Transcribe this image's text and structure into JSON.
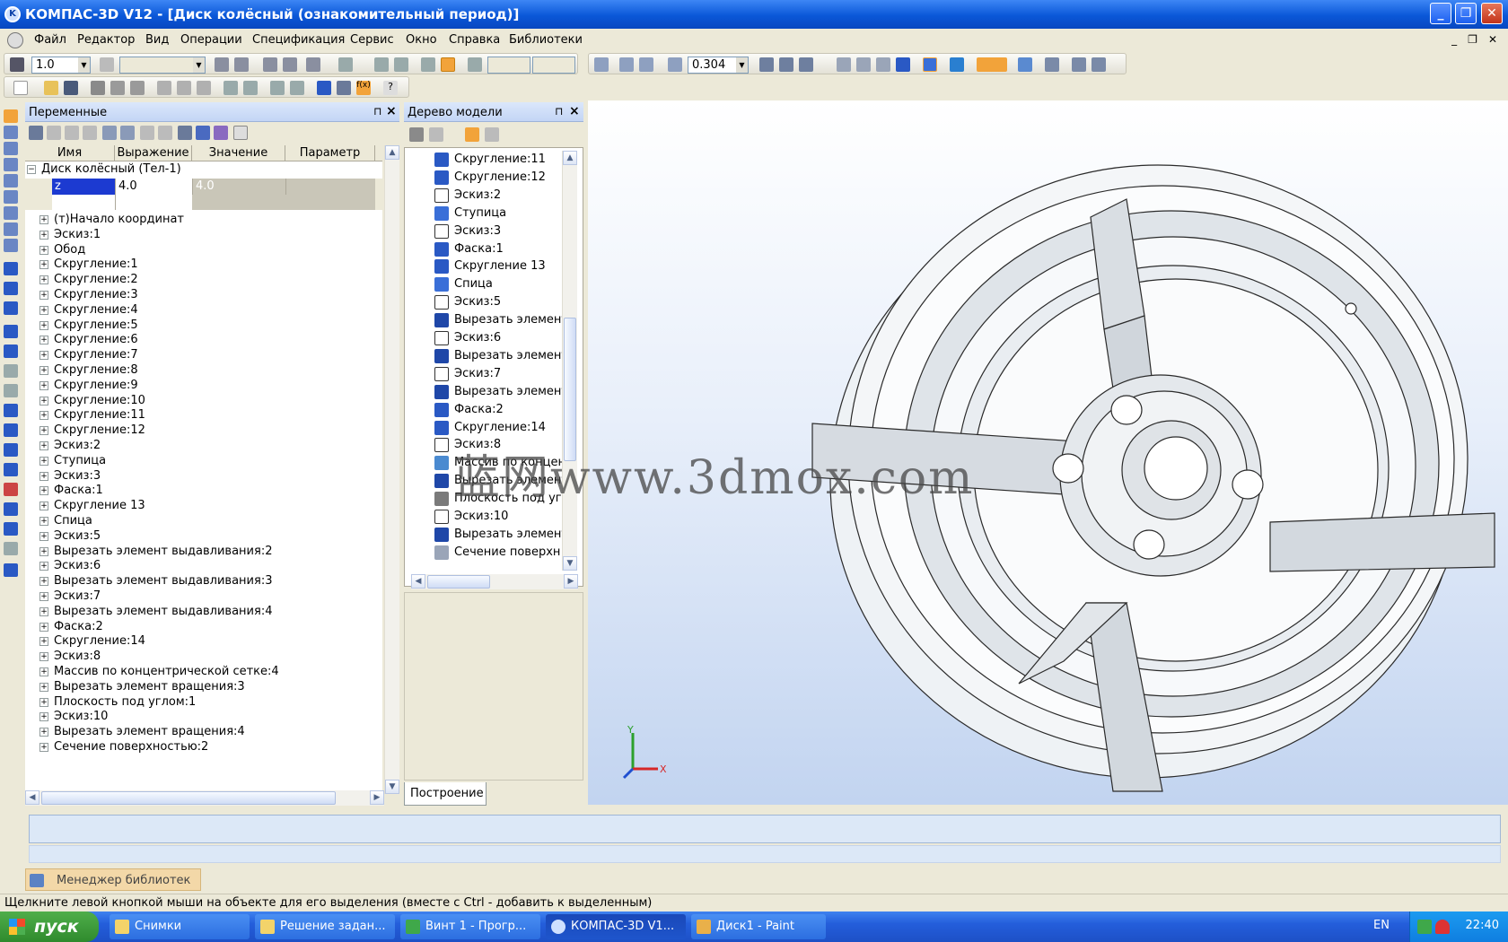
{
  "window": {
    "title": "КОМПАС-3D V12 - [Диск колёсный (ознакомительный период)]",
    "buttons": [
      "_",
      "❐",
      "✕"
    ]
  },
  "menu": {
    "items": [
      "Файл",
      "Редактор",
      "Вид",
      "Операции",
      "Спецификация",
      "Сервис",
      "Окно",
      "Справка",
      "Библиотеки"
    ]
  },
  "toolbar": {
    "step_value": "1.0",
    "zoom_value": "0.304"
  },
  "variables_panel": {
    "title": "Переменные",
    "columns": [
      "Имя",
      "Выражение",
      "Значение",
      "Параметр"
    ],
    "root": "Диск колёсный (Тел-1)",
    "var_name": "z",
    "var_expr": "4.0",
    "var_value": "4.0",
    "items": [
      "(т)Начало координат",
      "Эскиз:1",
      "Обод",
      "Скругление:1",
      "Скругление:2",
      "Скругление:3",
      "Скругление:4",
      "Скругление:5",
      "Скругление:6",
      "Скругление:7",
      "Скругление:8",
      "Скругление:9",
      "Скругление:10",
      "Скругление:11",
      "Скругление:12",
      "Эскиз:2",
      "Ступица",
      "Эскиз:3",
      "Фаска:1",
      "Скругление 13",
      "Спица",
      "Эскиз:5",
      "Вырезать элемент выдавливания:2",
      "Эскиз:6",
      "Вырезать элемент выдавливания:3",
      "Эскиз:7",
      "Вырезать элемент выдавливания:4",
      "Фаска:2",
      "Скругление:14",
      "Эскиз:8",
      "Массив по концентрической сетке:4",
      "Вырезать элемент вращения:3",
      "Плоскость под углом:1",
      "Эскиз:10",
      "Вырезать элемент вращения:4",
      "Сечение поверхностью:2"
    ]
  },
  "model_tree": {
    "title": "Дерево модели",
    "tab": "Построение",
    "items": [
      {
        "label": "Скругление:11",
        "icon": "fillet"
      },
      {
        "label": "Скругление:12",
        "icon": "fillet"
      },
      {
        "label": "Эскиз:2",
        "icon": "sketch"
      },
      {
        "label": "Ступица",
        "icon": "rotate"
      },
      {
        "label": "Эскиз:3",
        "icon": "sketch"
      },
      {
        "label": "Фаска:1",
        "icon": "fillet"
      },
      {
        "label": "Скругление 13",
        "icon": "fillet"
      },
      {
        "label": "Спица",
        "icon": "rotate"
      },
      {
        "label": "Эскиз:5",
        "icon": "sketch"
      },
      {
        "label": "Вырезать элемент",
        "icon": "cut"
      },
      {
        "label": "Эскиз:6",
        "icon": "sketch"
      },
      {
        "label": "Вырезать элемент",
        "icon": "cut"
      },
      {
        "label": "Эскиз:7",
        "icon": "sketch"
      },
      {
        "label": "Вырезать элемент",
        "icon": "cut"
      },
      {
        "label": "Фаска:2",
        "icon": "fillet"
      },
      {
        "label": "Скругление:14",
        "icon": "fillet"
      },
      {
        "label": "Эскиз:8",
        "icon": "sketch"
      },
      {
        "label": "Массив по концен",
        "icon": "array"
      },
      {
        "label": "Вырезать элемент",
        "icon": "cut"
      },
      {
        "label": "Плоскость под уг.",
        "icon": "plane"
      },
      {
        "label": "Эскиз:10",
        "icon": "sketch"
      },
      {
        "label": "Вырезать элемент",
        "icon": "cut"
      },
      {
        "label": "Сечение поверхн",
        "icon": "section"
      }
    ]
  },
  "viewport": {
    "watermark": "蓝网www.3dmox.com",
    "axis_x": "X",
    "axis_y": "Y"
  },
  "library_tab": "Менеджер библиотек",
  "status": "Щелкните левой кнопкой мыши на объекте для его выделения (вместе с Ctrl - добавить к выделенным)",
  "taskbar": {
    "start": "пуск",
    "buttons": [
      "Снимки",
      "Решение задан...",
      "Винт 1 - Прогр...",
      "КОМПАС-3D V1...",
      "Диск1 - Paint"
    ],
    "lang": "EN",
    "clock": "22:40"
  },
  "colors": {
    "accent": "#0a57d8",
    "panel": "#ece9d8",
    "selection": "#1c3ad1",
    "icon_blue": "#2a59c4"
  }
}
